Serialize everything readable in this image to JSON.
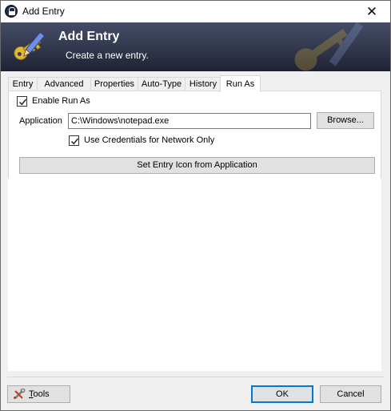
{
  "window": {
    "title": "Add Entry",
    "close_glyph": "✕"
  },
  "banner": {
    "title": "Add Entry",
    "subtitle": "Create a new entry."
  },
  "tabs": [
    {
      "label": "Entry"
    },
    {
      "label": "Advanced"
    },
    {
      "label": "Properties"
    },
    {
      "label": "Auto-Type"
    },
    {
      "label": "History"
    },
    {
      "label": "Run As",
      "active": true
    }
  ],
  "run_as": {
    "enable_label": "Enable Run As",
    "enable_checked": true,
    "application_label": "Application",
    "application_value": "C:\\Windows\\notepad.exe",
    "browse_label": "Browse...",
    "network_label": "Use Credentials for Network Only",
    "network_checked": true,
    "set_icon_label": "Set Entry Icon from Application"
  },
  "footer": {
    "tools_label_first": "T",
    "tools_label_rest": "ools",
    "ok_label": "OK",
    "cancel_label": "Cancel"
  },
  "icons": {
    "app_icon": "lock-icon",
    "banner_icon": "key-pencil-icon",
    "tools_icon": "wrench-icon"
  }
}
